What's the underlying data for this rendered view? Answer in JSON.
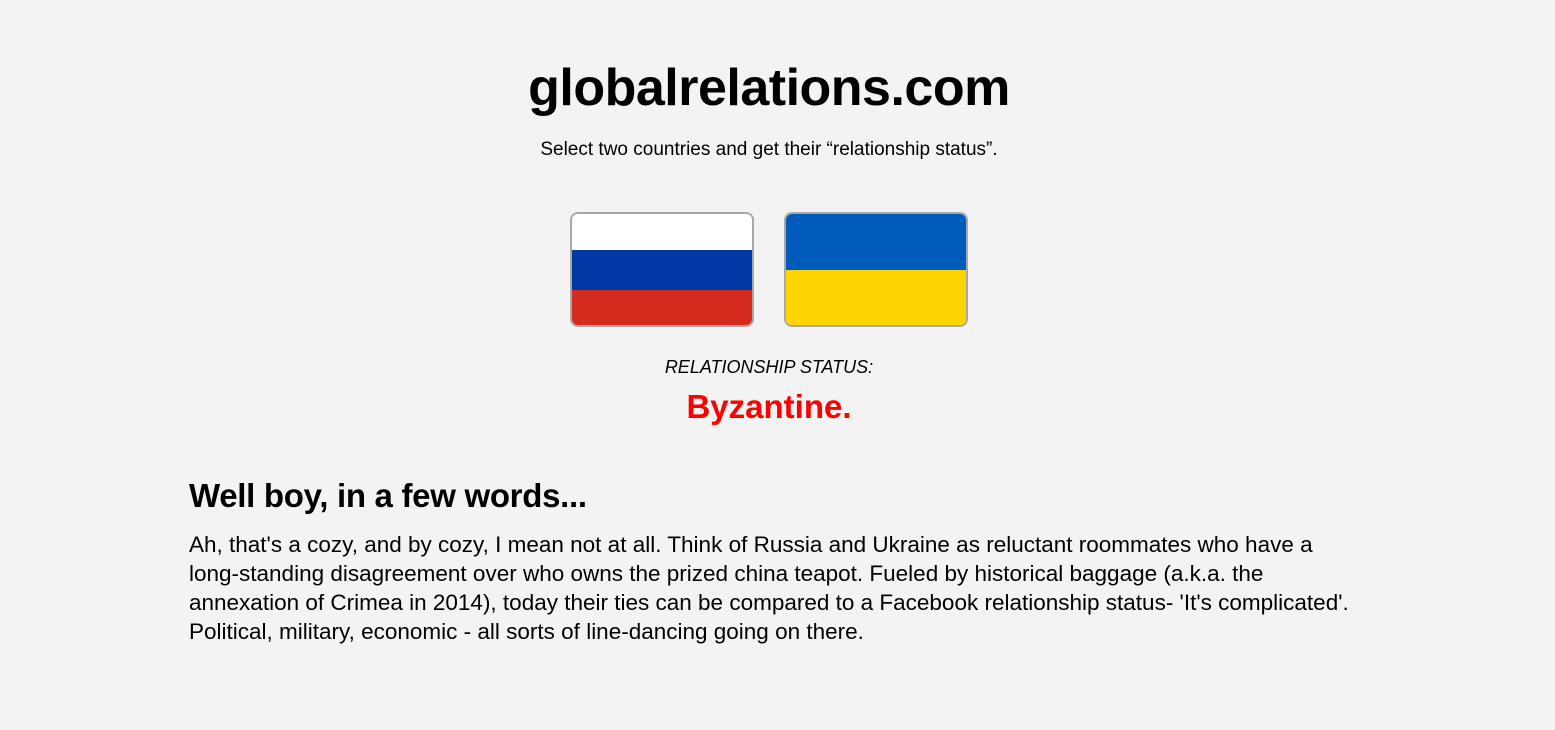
{
  "header": {
    "title": "globalrelations.com",
    "tagline": "Select two countries and get their “relationship status”."
  },
  "selection": {
    "country_a": {
      "name": "Russia",
      "flag_stripes": [
        "#ffffff",
        "#0039a6",
        "#d52b1e"
      ]
    },
    "country_b": {
      "name": "Ukraine",
      "flag_stripes": [
        "#005bbb",
        "#ffd500"
      ]
    }
  },
  "relationship": {
    "label": "RELATIONSHIP STATUS:",
    "status": "Byzantine.",
    "status_color": "#ff0000"
  },
  "explanation": {
    "heading": "Well boy, in a few words...",
    "body": "Ah, that's a cozy, and by cozy, I mean not at all. Think of Russia and Ukraine as reluctant roommates who have a long-standing disagreement over who owns the prized china teapot. Fueled by historical baggage (a.k.a. the annexation of Crimea in 2014), today their ties can be compared to a Facebook relationship status- 'It's complicated'. Political, military, economic - all sorts of line-dancing going on there."
  }
}
